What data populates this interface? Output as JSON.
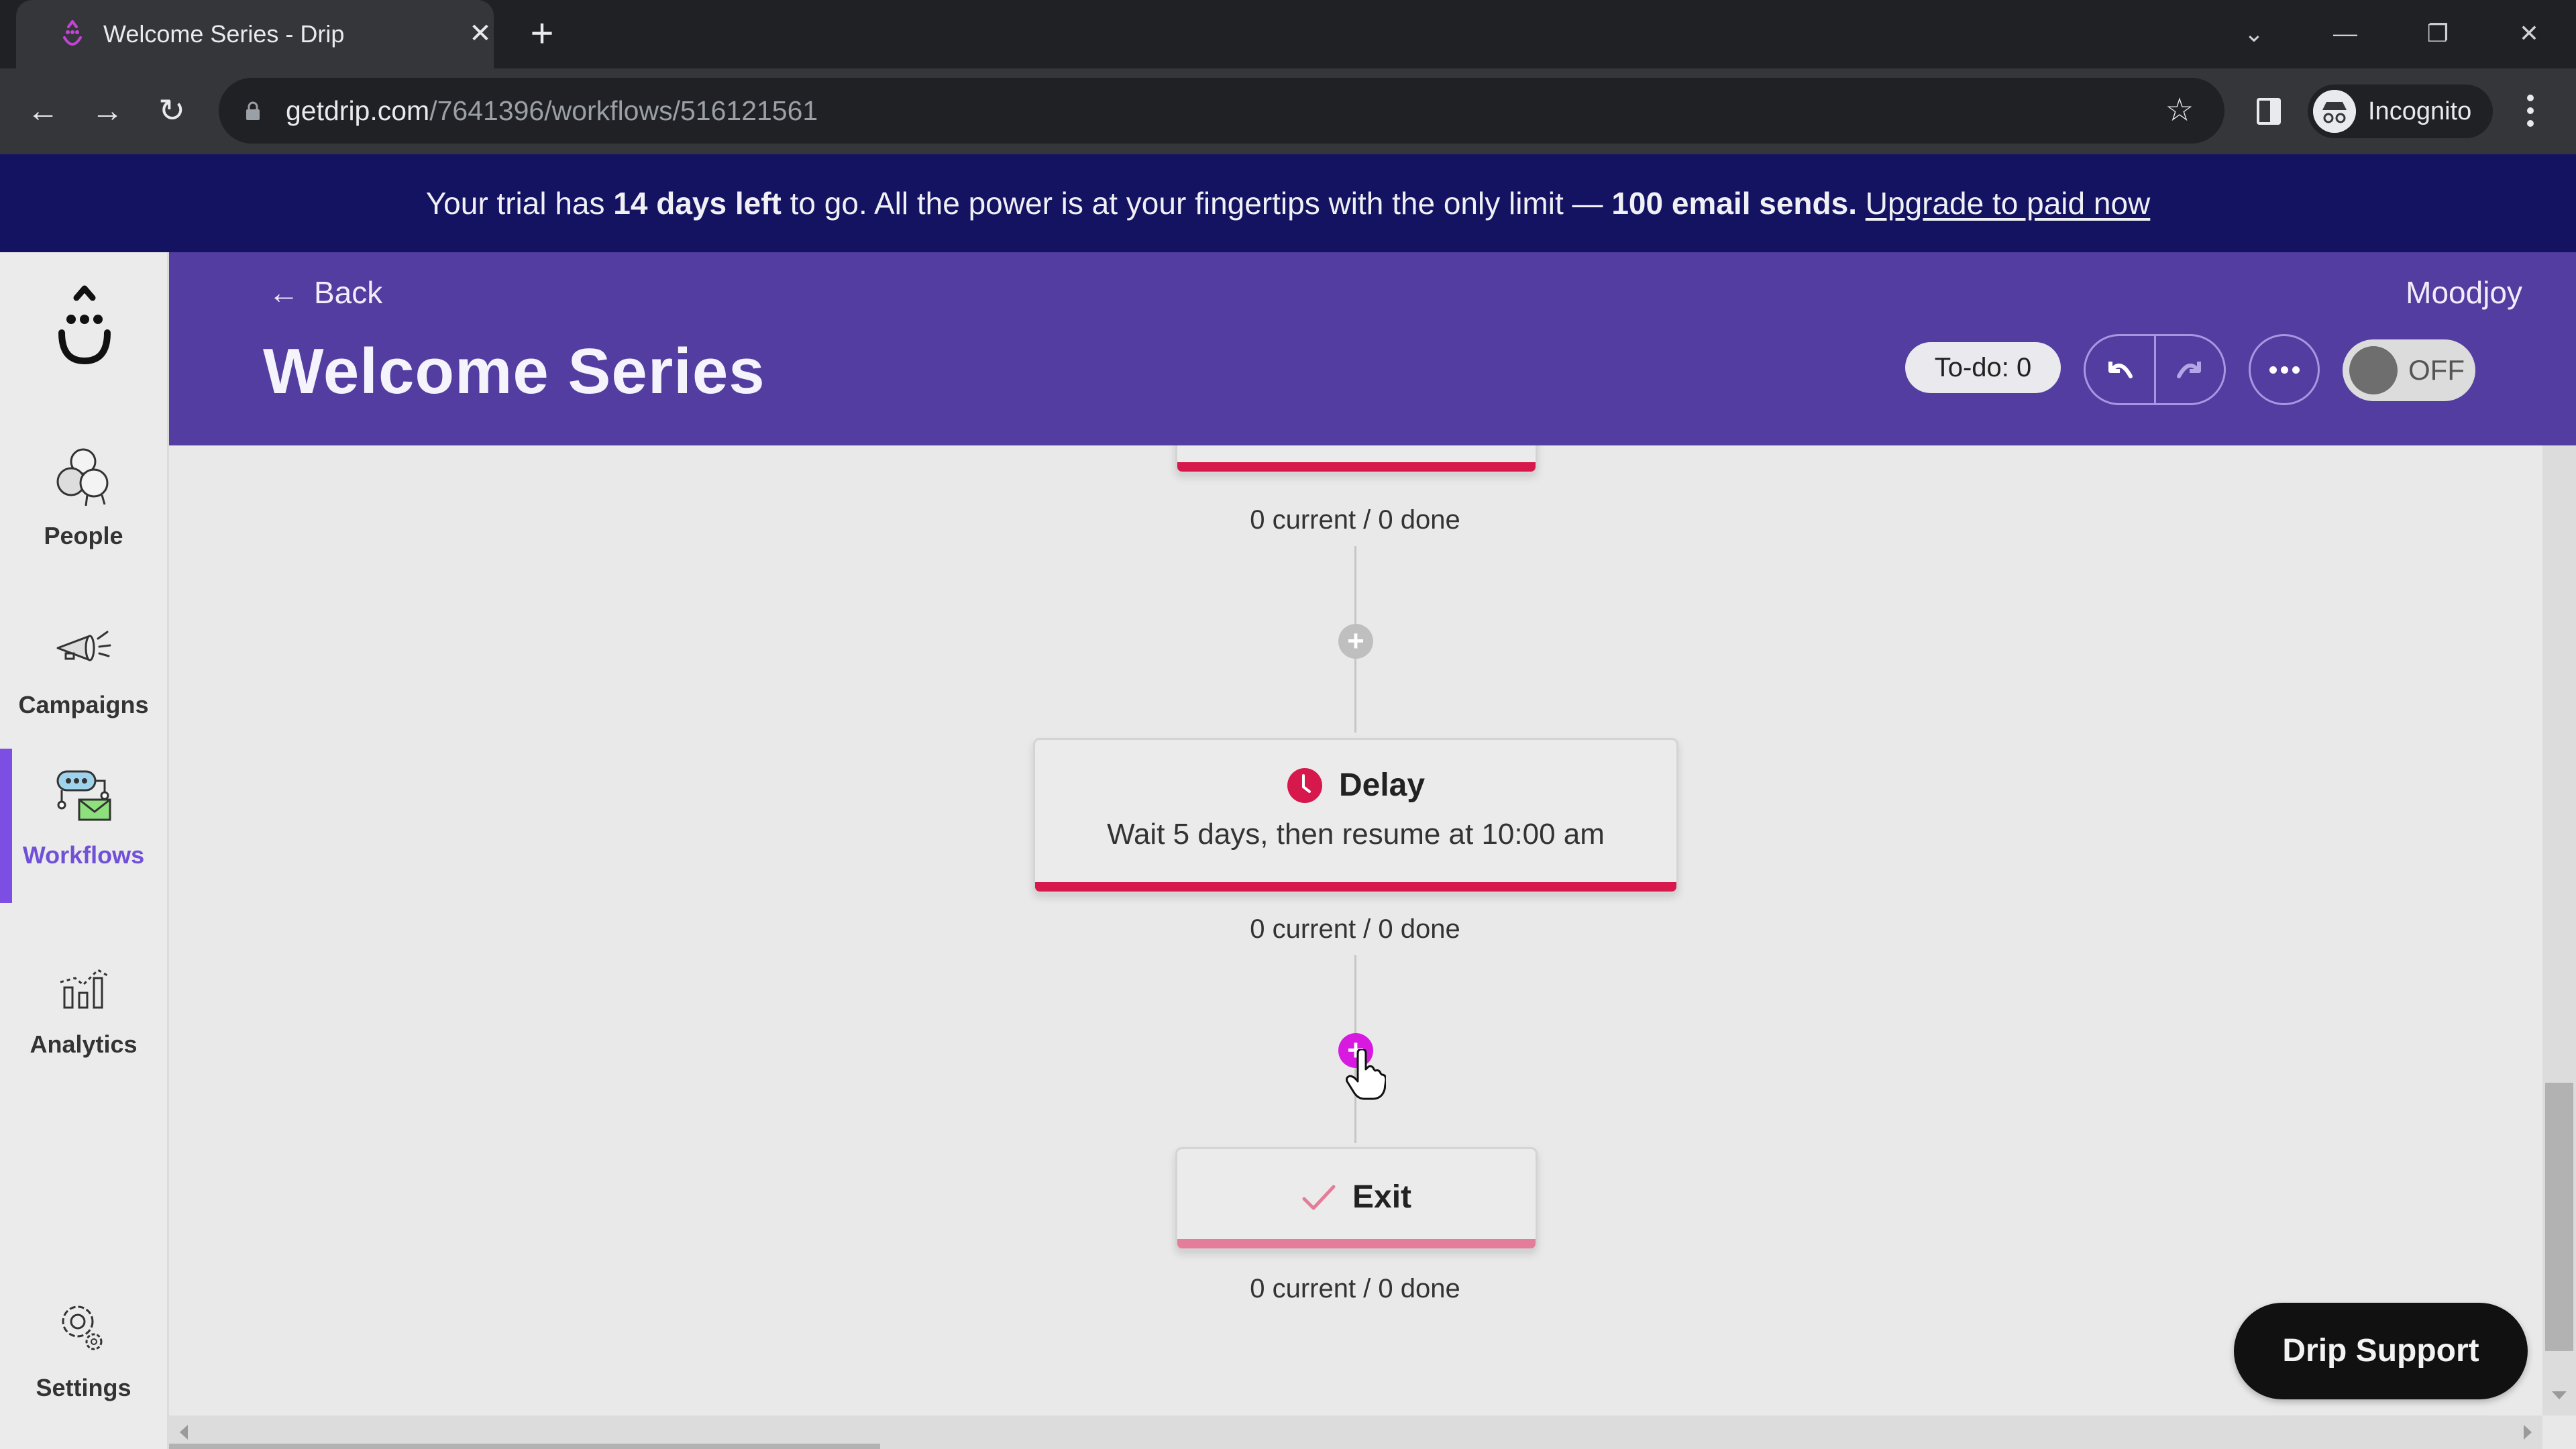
{
  "browser": {
    "tab_title": "Welcome Series - Drip",
    "url_host": "getdrip.com",
    "url_path": "/7641396/workflows/516121561",
    "profile_label": "Incognito"
  },
  "banner": {
    "text_1": "Your trial has ",
    "bold_1": "14 days left",
    "text_2": " to go. All the power is at your fingertips with the only limit — ",
    "bold_2": "100 email sends.",
    "link": "Upgrade to paid now"
  },
  "sidebar": {
    "items": [
      {
        "label": "People",
        "icon": "people-icon"
      },
      {
        "label": "Campaigns",
        "icon": "megaphone-icon"
      },
      {
        "label": "Workflows",
        "icon": "workflow-icon",
        "active": true
      },
      {
        "label": "Analytics",
        "icon": "analytics-icon"
      },
      {
        "label": "Settings",
        "icon": "gear-icon"
      }
    ],
    "active_color": "#7c4ee4"
  },
  "header": {
    "back_label": "Back",
    "title": "Welcome Series",
    "account": "Moodjoy",
    "todo_label": "To-do: 0",
    "toggle_state": "OFF",
    "bg_color": "#533da0"
  },
  "workflow": {
    "nodes": [
      {
        "type": "partial-card",
        "stats": "0 current / 0 done"
      },
      {
        "type": "delay",
        "title": "Delay",
        "description": "Wait 5 days, then resume at 10:00 am",
        "stats": "0 current / 0 done",
        "accent": "#d6184c"
      },
      {
        "type": "exit",
        "title": "Exit",
        "stats": "0 current / 0 done",
        "accent": "#e47d9a"
      }
    ],
    "add_step_hover_color": "#d81ae0"
  },
  "support": {
    "label": "Drip Support"
  }
}
